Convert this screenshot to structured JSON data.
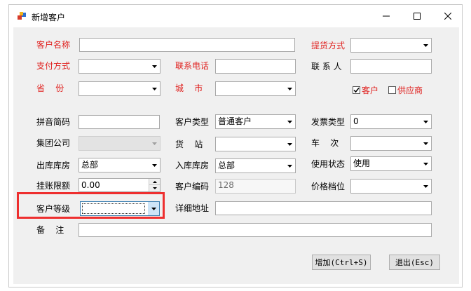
{
  "window": {
    "title": "新增客户"
  },
  "labels": {
    "customer_name": "客户名称",
    "pickup_method": "提货方式",
    "payment_method": "支付方式",
    "contact_phone": "联系电话",
    "contact_person": "联 系 人",
    "province": "省    份",
    "city": "城    市",
    "pinyin_code": "拼音简码",
    "customer_type": "客户类型",
    "invoice_type": "发票类型",
    "group_company": "集团公司",
    "station": "货    站",
    "train_no": "车    次",
    "outbound_warehouse": "出库库房",
    "inbound_warehouse": "入库库房",
    "usage_status": "使用状态",
    "credit_limit": "挂账限额",
    "customer_code": "客户编码",
    "price_tier": "价格档位",
    "customer_level": "客户等级",
    "detail_address": "详细地址",
    "remarks": "备    注"
  },
  "fields": {
    "customer_type_value": "普通客户",
    "invoice_type_value": "0",
    "outbound_warehouse_value": "总部",
    "inbound_warehouse_value": "总部",
    "usage_status_value": "使用",
    "credit_limit_value": "0.00",
    "customer_code_value": "128"
  },
  "checkboxes": {
    "customer": {
      "label": "客户",
      "checked": true
    },
    "supplier": {
      "label": "供应商",
      "checked": false
    }
  },
  "buttons": {
    "add": "增加(Ctrl+S)",
    "exit": "退出(Esc)"
  },
  "colors": {
    "required_label": "#e0201e",
    "highlight": "#ee2f2f"
  }
}
